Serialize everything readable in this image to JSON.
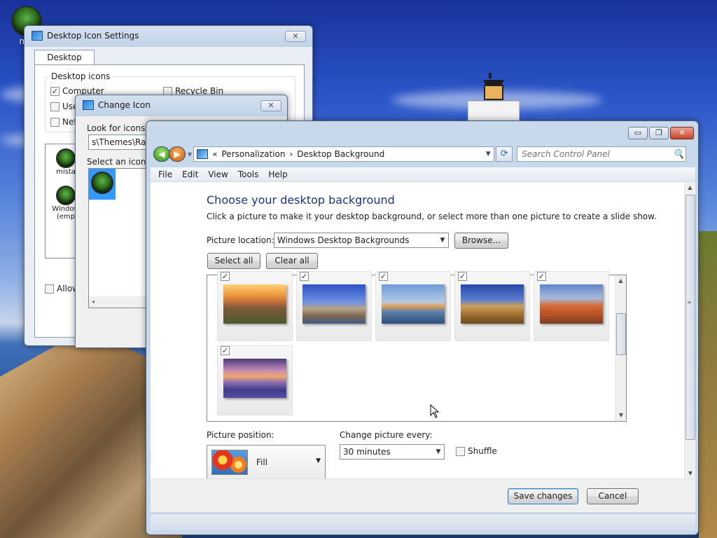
{
  "desktop": {
    "icon_label": "mis"
  },
  "desktop_icon_settings": {
    "title": "Desktop Icon Settings",
    "close_glyph": "✕",
    "tab": "Desktop Icons",
    "group_label": "Desktop icons",
    "checkboxes": [
      {
        "label": "Computer",
        "checked": true
      },
      {
        "label": "Recycle Bin",
        "checked": false
      },
      {
        "label": "Use",
        "checked": false
      },
      {
        "label": "Netw",
        "checked": false
      }
    ],
    "icon_labels": [
      "mista",
      "Window",
      "(emp"
    ],
    "allow_label": "Allow"
  },
  "change_icon": {
    "title": "Change Icon",
    "close_glyph": "✕",
    "look_label": "Look for icons in f",
    "path_value": "s\\Themes\\Razer",
    "select_label": "Select an icon fro"
  },
  "personalization": {
    "caption_buttons": {
      "minimize": "▭",
      "maximize": "❐",
      "close": "✕"
    },
    "nav": {
      "back": "◀",
      "forward": "▶",
      "breadcrumb_prefix": "«",
      "crumbs": [
        "Personalization",
        "Desktop Background"
      ],
      "separator": "›",
      "search_placeholder": "Search Control Panel"
    },
    "menu": [
      "File",
      "Edit",
      "View",
      "Tools",
      "Help"
    ],
    "heading": "Choose your desktop background",
    "subtitle": "Click a picture to make it your desktop background, or select more than one picture to create a slide show.",
    "picture_location_label": "Picture location:",
    "picture_location_value": "Windows Desktop Backgrounds",
    "browse_label": "Browse...",
    "select_all_label": "Select all",
    "clear_all_label": "Clear all",
    "pictures": [
      {
        "name": "sunset",
        "checked": true
      },
      {
        "name": "lighthouse",
        "checked": true
      },
      {
        "name": "rock",
        "checked": true
      },
      {
        "name": "hay",
        "checked": true
      },
      {
        "name": "arch",
        "checked": true
      },
      {
        "name": "lake",
        "checked": true
      }
    ],
    "picture_position_label": "Picture position:",
    "picture_position_value": "Fill",
    "change_every_label": "Change picture every:",
    "change_every_value": "30 minutes",
    "shuffle_label": "Shuffle",
    "shuffle_checked": false,
    "save_label": "Save changes",
    "cancel_label": "Cancel"
  },
  "icons": {
    "checkmark": "✓",
    "dropdown": "▼",
    "refresh": "⟳",
    "search": "🔍",
    "scroll_up": "▲",
    "scroll_down": "▼"
  }
}
